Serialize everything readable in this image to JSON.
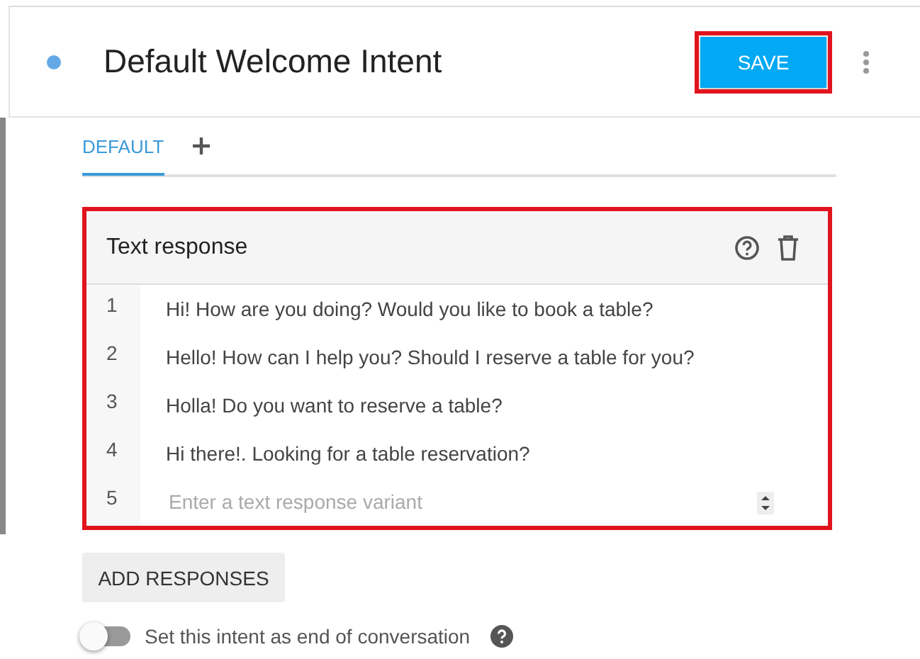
{
  "intent": {
    "title": "Default Welcome Intent",
    "save_button": "SAVE",
    "highlighted": true
  },
  "tabs": [
    {
      "label": "DEFAULT",
      "selected": true
    }
  ],
  "response_card": {
    "title": "Text response",
    "highlighted": true,
    "rows": [
      {
        "number": "1",
        "text": "Hi! How are you doing? Would you like to book a table?"
      },
      {
        "number": "2",
        "text": "Hello! How can I help you? Should I reserve a table for you?"
      },
      {
        "number": "3",
        "text": "Holla! Do you want to reserve a table?"
      },
      {
        "number": "4",
        "text": "Hi there!. Looking for a table reservation?"
      }
    ],
    "new_row": {
      "number": "5",
      "placeholder": "Enter a text response variant"
    }
  },
  "add_button": "ADD RESPONSES",
  "end_toggle": {
    "label": "Set this intent as end of conversation",
    "on": false
  }
}
